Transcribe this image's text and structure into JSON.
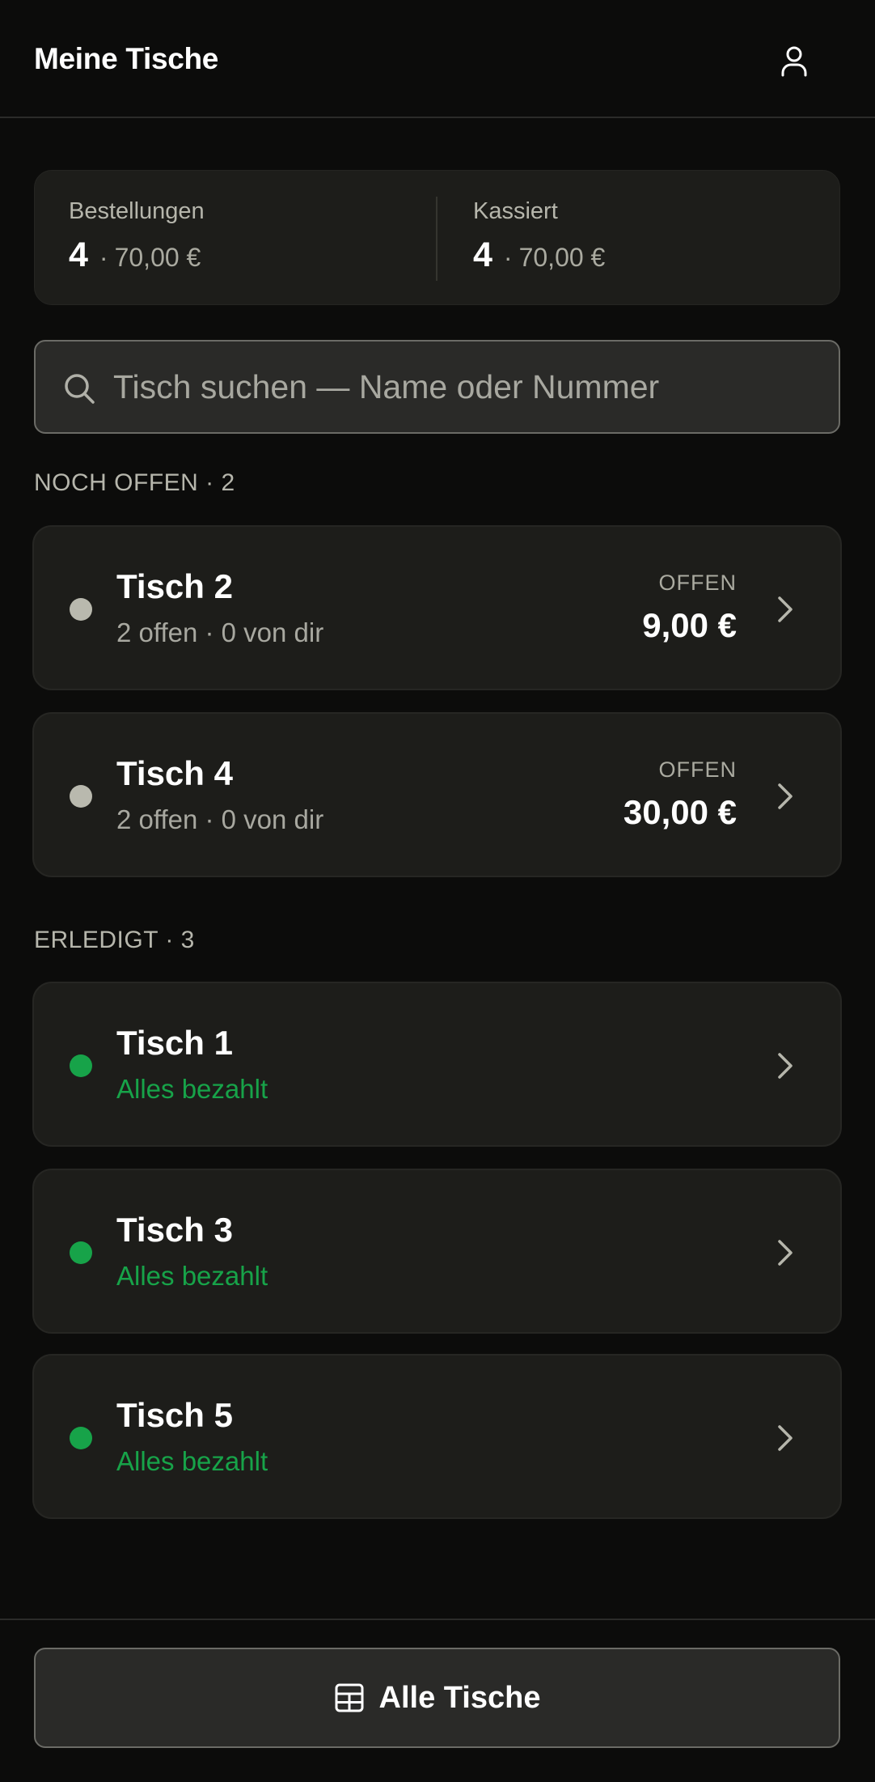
{
  "header": {
    "title": "Meine Tische",
    "profile_icon": "user-icon"
  },
  "summary": {
    "orders": {
      "label": "Bestellungen",
      "count": "4",
      "separator": "·",
      "amount": "70,00 €"
    },
    "collected": {
      "label": "Kassiert",
      "count": "4",
      "separator": "·",
      "amount": "70,00 €"
    }
  },
  "search": {
    "placeholder": "Tisch suchen — Name oder Nummer",
    "value": "",
    "icon": "search-icon"
  },
  "sections": {
    "open": {
      "title": "NOCH OFFEN · 2",
      "items": [
        {
          "name": "Tisch 2",
          "subtitle": "2 offen · 0 von dir",
          "badge": "OFFEN",
          "amount": "9,00 €"
        },
        {
          "name": "Tisch 4",
          "subtitle": "2 offen · 0 von dir",
          "badge": "OFFEN",
          "amount": "30,00 €"
        }
      ]
    },
    "done": {
      "title": "ERLEDIGT · 3",
      "items": [
        {
          "name": "Tisch 1",
          "subtitle": "Alles bezahlt"
        },
        {
          "name": "Tisch 3",
          "subtitle": "Alles bezahlt"
        },
        {
          "name": "Tisch 5",
          "subtitle": "Alles bezahlt"
        }
      ]
    }
  },
  "footer": {
    "all_tables_label": "Alle Tische",
    "icon": "table-grid-icon"
  },
  "colors": {
    "background": "#0c0c0b",
    "card": "#1d1d1a",
    "paid_green": "#17a349",
    "open_dot": "#b9b9ae"
  }
}
